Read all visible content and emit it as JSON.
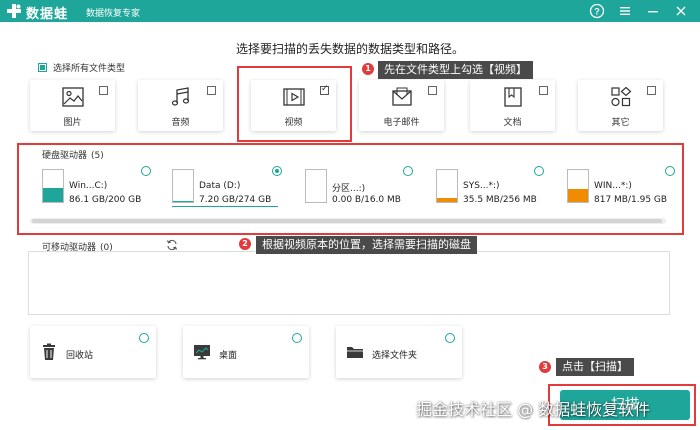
{
  "titlebar": {
    "app_name": "数据蛙",
    "subtitle": "数据恢复专家",
    "bg_color": "#1fa69a",
    "icons": [
      "logo-icon",
      "help-icon",
      "menu-icon",
      "minimize-icon",
      "close-icon"
    ]
  },
  "instruction": "选择要扫描的丢失数据的数据类型和路径。",
  "select_all": {
    "label": "选择所有文件类型",
    "checked": true
  },
  "file_types": [
    {
      "label": "图片",
      "icon": "image-icon",
      "checked": false
    },
    {
      "label": "音频",
      "icon": "music-icon",
      "checked": false
    },
    {
      "label": "视频",
      "icon": "video-icon",
      "checked": true
    },
    {
      "label": "电子邮件",
      "icon": "email-icon",
      "checked": false
    },
    {
      "label": "文档",
      "icon": "document-icon",
      "checked": false
    },
    {
      "label": "其它",
      "icon": "other-icon",
      "checked": false
    }
  ],
  "annotations": {
    "step1": {
      "num": "1",
      "text": "先在文件类型上勾选【视频】"
    },
    "step2": {
      "num": "2",
      "text": "根据视频原本的位置，选择需要扫描的磁盘"
    },
    "step3": {
      "num": "3",
      "text": "点击【扫描】"
    },
    "color": "#e23b3b"
  },
  "hard_drives": {
    "label": "硬盘驱动器",
    "count": "(5)",
    "items": [
      {
        "name": "Win...C:)",
        "size": "86.1 GB/200 GB",
        "used_fraction": 0.43,
        "fill_color": "#1fa69a",
        "selected": false
      },
      {
        "name": "Data (D:)",
        "size": "7.20 GB/274 GB",
        "used_fraction": 0.03,
        "fill_color": "#1fa69a",
        "selected": true
      },
      {
        "name": "分区...:)",
        "size": "0.00  B/16.0 MB",
        "used_fraction": 0.0,
        "fill_color": "#f08c00",
        "selected": false
      },
      {
        "name": "SYS...*:)",
        "size": "35.5 MB/256 MB",
        "used_fraction": 0.14,
        "fill_color": "#f08c00",
        "selected": false
      },
      {
        "name": "WIN...*:)",
        "size": "817 MB/1.95 GB",
        "used_fraction": 0.42,
        "fill_color": "#f08c00",
        "selected": false
      }
    ]
  },
  "removable": {
    "label": "可移动驱动器",
    "count": "(0)"
  },
  "locations": [
    {
      "label": "回收站",
      "icon": "recycle-bin-icon"
    },
    {
      "label": "桌面",
      "icon": "desktop-icon"
    },
    {
      "label": "选择文件夹",
      "icon": "folder-icon"
    }
  ],
  "scan_button": {
    "label": "扫描"
  },
  "watermark": "掘金技术社区 @ 数据蛙恢复软件"
}
